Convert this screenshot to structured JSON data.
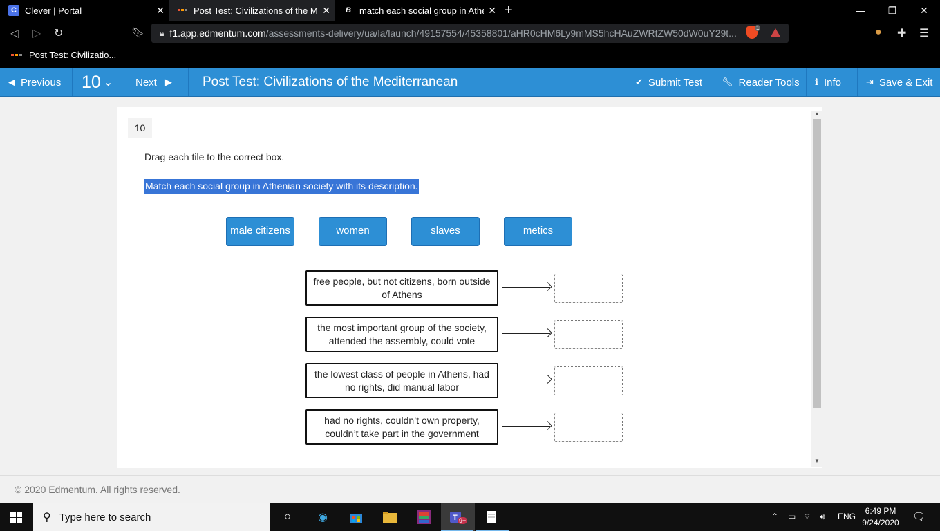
{
  "browser": {
    "tabs": [
      {
        "title": "Clever | Portal",
        "icon": "clever-icon",
        "icon_glyph": "C"
      },
      {
        "title": "Post Test: Civilizations of the Medit",
        "icon": "edmentum-icon",
        "active": true
      },
      {
        "title": "match each social group in Athenia",
        "icon": "brainly-icon",
        "icon_glyph": "B"
      }
    ],
    "new_tab_glyph": "+",
    "url_host": "f1.app.edmentum.com",
    "url_path": "/assessments-delivery/ua/la/launch/49157554/45358801/aHR0cHM6Ly9mMS5hcHAuZWRtZW50dW0uY29t...",
    "brave_badge": "1",
    "bookmark": "Post Test: Civilizatio..."
  },
  "app": {
    "previous_label": "Previous",
    "question_number": "10",
    "next_label": "Next",
    "title": "Post Test: Civilizations of the Mediterranean",
    "submit_label": "Submit Test",
    "reader_tools_label": "Reader Tools",
    "info_label": "Info",
    "save_exit_label": "Save & Exit"
  },
  "question": {
    "number": "10",
    "instruction": "Drag each tile to the correct box.",
    "prompt": "Match each social group in Athenian society with its description.",
    "tiles": [
      "male citizens",
      "women",
      "slaves",
      "metics"
    ],
    "descriptions": [
      "free people, but not citizens, born outside of Athens",
      "the most important group of the society, attended the assembly, could vote",
      "the lowest class of people in Athens, had no rights, did manual labor",
      "had no rights, couldn’t own property, couldn’t take part in the government"
    ]
  },
  "footer": {
    "copyright": "© 2020 Edmentum. All rights reserved."
  },
  "taskbar": {
    "search_placeholder": "Type here to search",
    "teams_badge": "9+",
    "language": "ENG",
    "time": "6:49 PM",
    "date": "9/24/2020"
  },
  "colors": {
    "app_header": "#2d8fd5",
    "tile": "#2d8fd5",
    "selection": "#3875d7"
  }
}
